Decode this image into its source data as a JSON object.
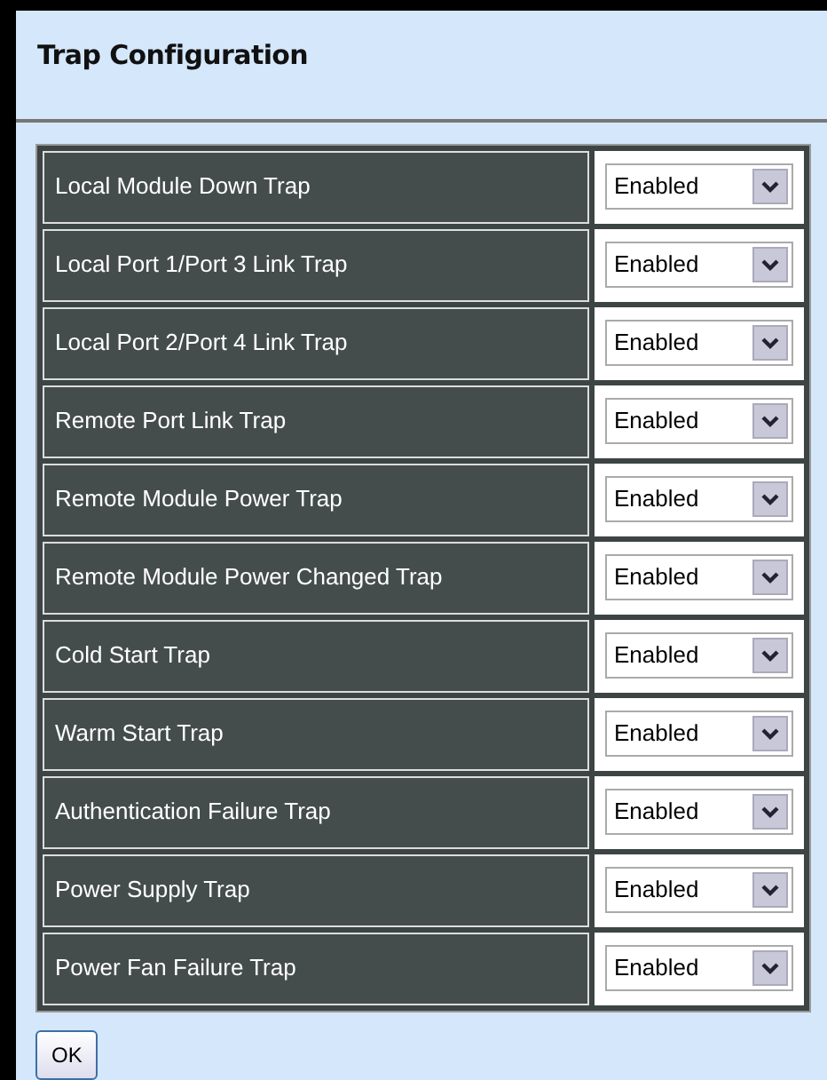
{
  "title": "Trap Configuration",
  "traps": [
    {
      "label": "Local Module Down Trap",
      "value": "Enabled"
    },
    {
      "label": "Local Port 1/Port 3 Link Trap",
      "value": "Enabled"
    },
    {
      "label": "Local Port 2/Port 4 Link Trap",
      "value": "Enabled"
    },
    {
      "label": "Remote Port Link Trap",
      "value": "Enabled"
    },
    {
      "label": "Remote Module Power Trap",
      "value": "Enabled"
    },
    {
      "label": "Remote Module Power Changed Trap",
      "value": "Enabled"
    },
    {
      "label": "Cold Start Trap",
      "value": "Enabled"
    },
    {
      "label": "Warm Start Trap",
      "value": "Enabled"
    },
    {
      "label": "Authentication Failure Trap",
      "value": "Enabled"
    },
    {
      "label": "Power Supply Trap",
      "value": "Enabled"
    },
    {
      "label": "Power Fan Failure Trap",
      "value": "Enabled"
    }
  ],
  "buttons": [
    "OK"
  ]
}
